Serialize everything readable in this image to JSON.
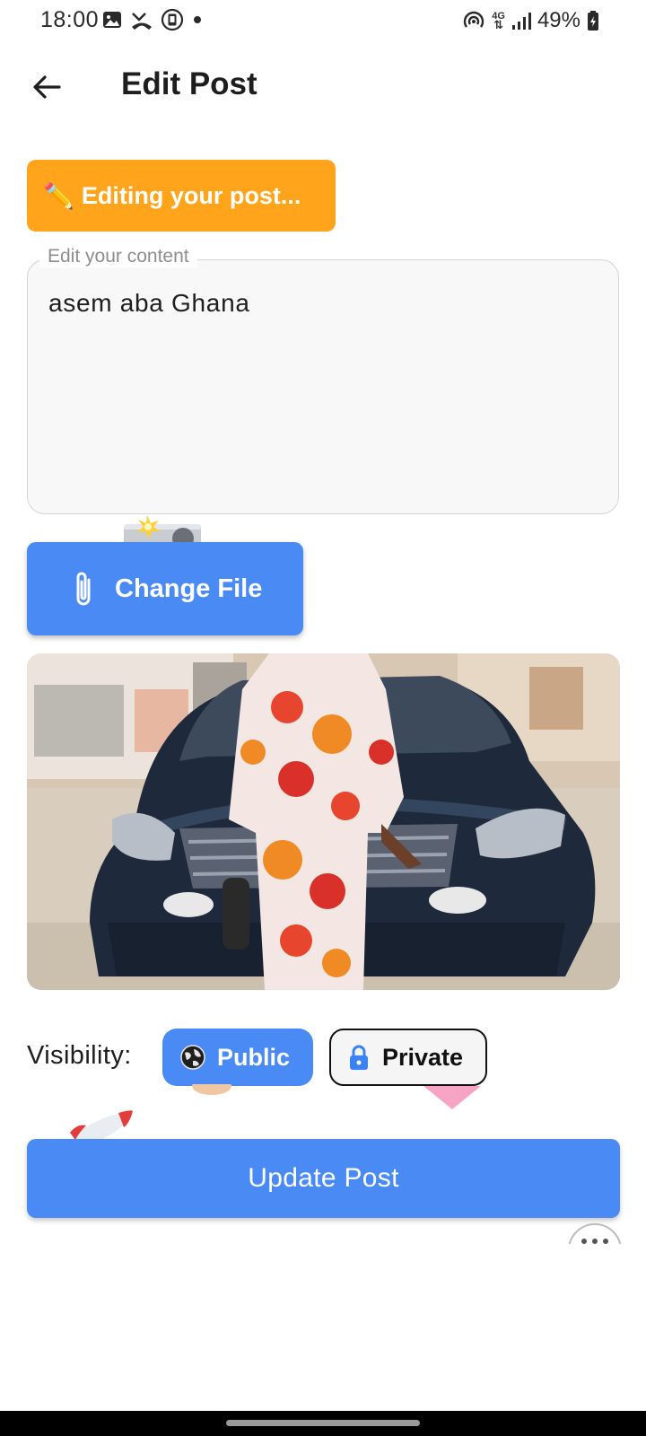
{
  "status_bar": {
    "time": "18:00",
    "left_icons": [
      "gallery-icon",
      "missed-call-icon",
      "screenshot-icon",
      "dot-icon"
    ],
    "network_label_top": "4G",
    "battery_text": "49%",
    "right_icons": [
      "hotspot-icon",
      "data-arrows-icon",
      "signal-icon",
      "battery-icon"
    ]
  },
  "app_bar": {
    "back_icon": "arrow-left-icon",
    "title": "Edit Post"
  },
  "banner": {
    "emoji": "✏️",
    "text": "Editing your post..."
  },
  "content_field": {
    "label": "Edit your content",
    "value": "asem aba Ghana"
  },
  "change_file": {
    "icon": "paperclip-icon",
    "label": "Change File"
  },
  "media": {
    "icon": "image-preview"
  },
  "visibility": {
    "label": "Visibility:",
    "options": [
      {
        "label": "Public",
        "icon": "globe-icon",
        "selected": true
      },
      {
        "label": "Private",
        "icon": "lock-icon",
        "selected": false
      }
    ]
  },
  "update_button": {
    "label": "Update Post"
  },
  "colors": {
    "accent": "#4a8af5",
    "banner": "#ffa41b",
    "text": "#1e1e1e"
  }
}
